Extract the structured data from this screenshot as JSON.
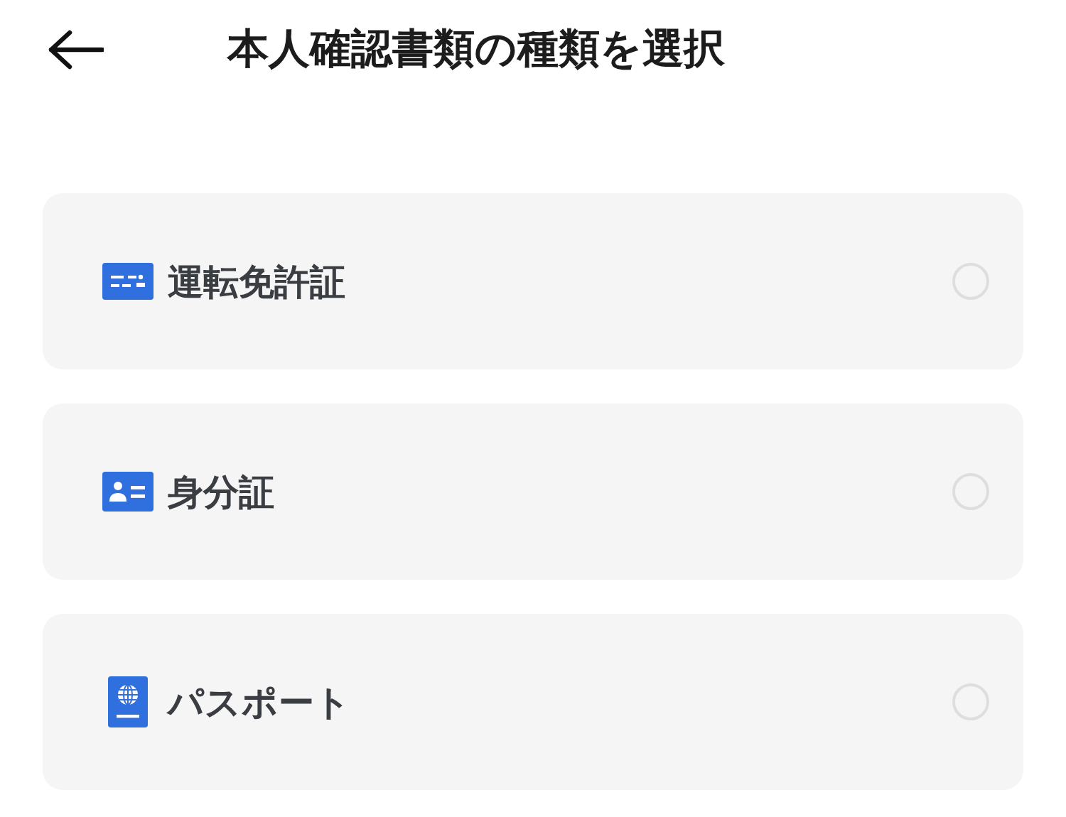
{
  "header": {
    "title": "本人確認書類の種類を選択"
  },
  "options": [
    {
      "kind": "license",
      "label": "運転免許証",
      "selected": false
    },
    {
      "kind": "id_card",
      "label": "身分証",
      "selected": false
    },
    {
      "kind": "passport",
      "label": "パスポート",
      "selected": false
    }
  ]
}
